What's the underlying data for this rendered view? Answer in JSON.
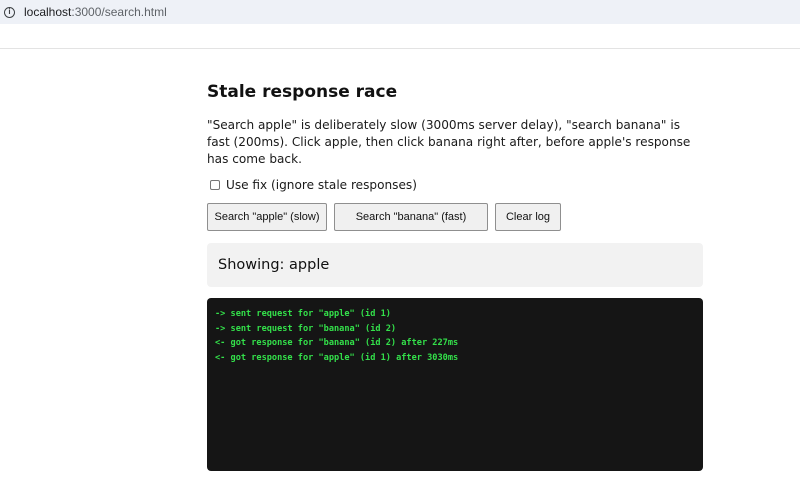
{
  "browser": {
    "url_host": "localhost",
    "url_path": ":3000/search.html"
  },
  "page": {
    "title": "Stale response race",
    "description": "\"Search apple\" is deliberately slow (3000ms server delay), \"search banana\" is fast (200ms). Click apple, then click banana right after, before apple's response has come back.",
    "fix_label": "Use fix (ignore stale responses)",
    "fix_checked": false,
    "buttons": {
      "apple": "Search \"apple\" (slow)",
      "banana": "Search \"banana\" (fast)",
      "clear": "Clear log"
    },
    "showing": "Showing: apple",
    "log": [
      "-> sent request for \"apple\" (id 1)",
      "-> sent request for \"banana\" (id 2)",
      "<- got response for \"banana\" (id 2) after 227ms",
      "<- got response for \"apple\" (id 1) after 3030ms"
    ]
  },
  "colors": {
    "log_background": "#151515",
    "log_text": "#33e04a",
    "panel_background": "#f2f2f2"
  }
}
